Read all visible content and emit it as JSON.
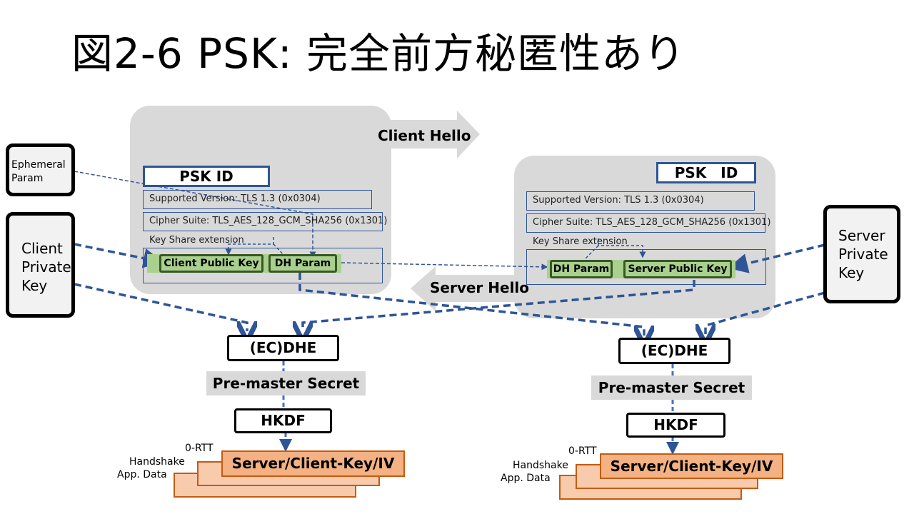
{
  "title": "図2-6 PSK: 完全前方秘匿性あり",
  "arrows": {
    "client_hello": "Client Hello",
    "server_hello": "Server Hello"
  },
  "client": {
    "ephemeral_param": [
      "Ephemeral",
      "Param"
    ],
    "private_key": [
      "Client",
      "Private",
      "Key"
    ],
    "psk_id": "PSK ID",
    "supported_version": "Supported Version: TLS 1.3 (0x0304)",
    "cipher_suite": "Cipher Suite: TLS_AES_128_GCM_SHA256 (0x1301)",
    "key_share": "Key Share extension",
    "public_key": "Client Public Key",
    "dh_param": "DH Param",
    "ecdhe": "(EC)DHE",
    "pre_master": "Pre-master Secret",
    "hkdf": "HKDF",
    "keys": "Server/Client-Key/IV",
    "labels": [
      "0-RTT",
      "Handshake",
      "App. Data"
    ]
  },
  "server": {
    "private_key": [
      "Server",
      "Private",
      "Key"
    ],
    "psk_id": "PSK　ID",
    "supported_version": "Supported Version: TLS 1.3 (0x0304)",
    "cipher_suite": "Cipher Suite: TLS_AES_128_GCM_SHA256 (0x1301)",
    "key_share": "Key Share extension",
    "dh_param": "DH Param",
    "public_key": "Server Public Key",
    "ecdhe": "(EC)DHE",
    "pre_master": "Pre-master Secret",
    "hkdf": "HKDF",
    "keys": "Server/Client-Key/IV",
    "labels": [
      "0-RTT",
      "Handshake",
      "App. Data"
    ]
  },
  "colors": {
    "panel": "#d9d9d9",
    "arrow_gray": "#d9d9d9",
    "blue": "#2f5597",
    "dash_blue": "#4472c4",
    "green": "#a9d08e",
    "green_border": "#385723",
    "orange": "#f4b183",
    "orange_border": "#c55a11"
  }
}
